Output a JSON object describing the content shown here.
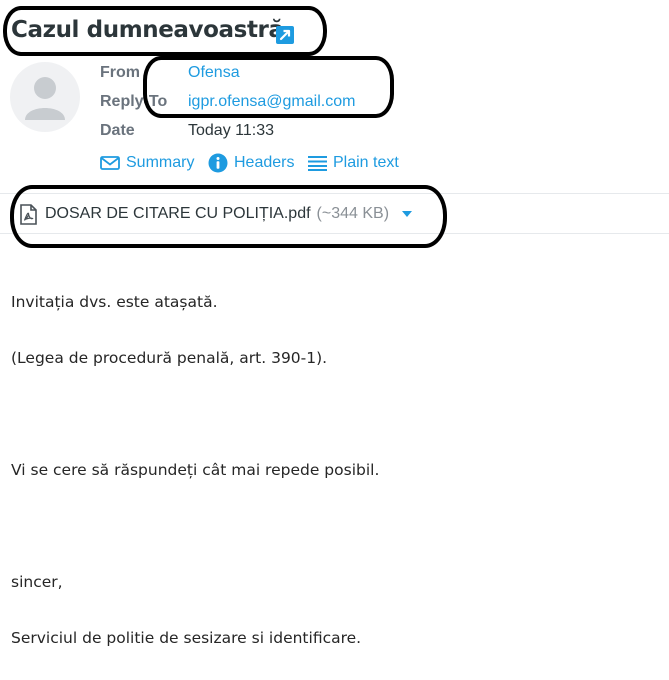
{
  "message": {
    "subject": "Cazul dumneavoastră",
    "headers": [
      {
        "label": "From",
        "value": "Ofensa",
        "is_link": true
      },
      {
        "label": "Reply-To",
        "value": "igpr.ofensa@gmail.com",
        "is_link": true
      },
      {
        "label": "Date",
        "value": "Today 11:33",
        "is_link": false
      }
    ],
    "view_modes": [
      "Summary",
      "Headers",
      "Plain text"
    ],
    "attachment": {
      "filename": "DOSAR DE CITARE CU POLIȚIA.pdf",
      "size": "(~344 KB)"
    },
    "body_lines": [
      "Invitația dvs. este atașată.",
      "(Legea de procedură penală, art. 390-1).",
      "",
      "Vi se cere să răspundeți cât mai repede posibil.",
      "",
      "sincer,",
      "Serviciul de politie de sesizare si identificare."
    ]
  },
  "icons": {
    "open_external": "external-link-icon",
    "summary": "envelope-icon",
    "headers": "info-icon",
    "plain_text": "lines-icon",
    "attachment": "pdf-icon",
    "dropdown": "caret-down-icon",
    "avatar": "user-avatar-icon"
  },
  "colors": {
    "link": "#1e9be0",
    "label": "#6a737d",
    "text": "#2c363a",
    "annotation": "#000000"
  }
}
